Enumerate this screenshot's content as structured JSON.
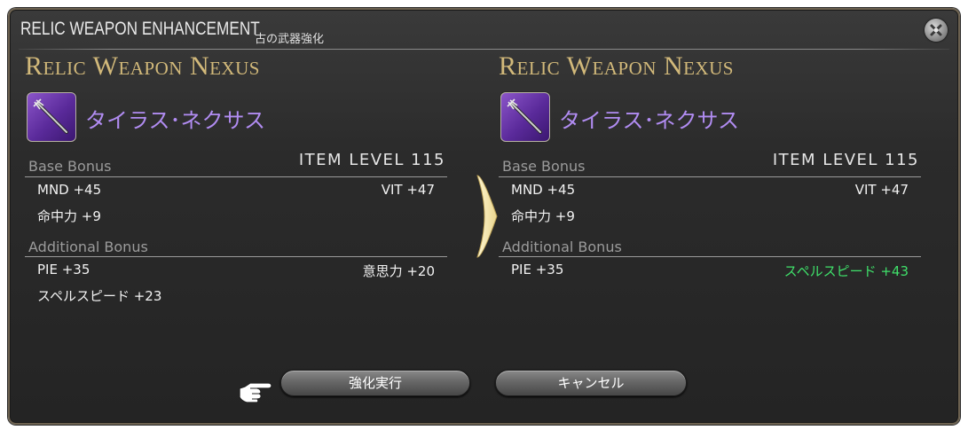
{
  "window": {
    "title_en": "RELIC WEAPON ENHANCEMENT",
    "title_jp": "古の武器強化"
  },
  "before": {
    "header": "Relic Weapon Nexus",
    "weapon_name": "タイラス･ネクサス",
    "base_bonus_label": "Base Bonus",
    "item_level": "ITEM LEVEL 115",
    "base_stats": [
      {
        "label": "MND +45"
      },
      {
        "label": "VIT +47"
      },
      {
        "label": "命中力 +9"
      }
    ],
    "additional_bonus_label": "Additional Bonus",
    "additional_stats": [
      {
        "label": "PIE +35"
      },
      {
        "label": "意思力 +20"
      },
      {
        "label": "スペルスピード +23"
      }
    ]
  },
  "after": {
    "header": "Relic Weapon Nexus",
    "weapon_name": "タイラス･ネクサス",
    "base_bonus_label": "Base Bonus",
    "item_level": "ITEM LEVEL 115",
    "base_stats": [
      {
        "label": "MND +45"
      },
      {
        "label": "VIT +47"
      },
      {
        "label": "命中力 +9"
      }
    ],
    "additional_bonus_label": "Additional Bonus",
    "additional_stats": [
      {
        "label": "PIE +35"
      },
      {
        "label": "スペルスピード +43"
      }
    ]
  },
  "buttons": {
    "execute_label": "強化実行",
    "cancel_label": "キャンセル"
  },
  "colors": {
    "header_gold": "#d2b97a",
    "weapon_name_purple": "#b18cf2",
    "improved_stat_green": "#3fe06a",
    "arrow_cream": "#f4e7b0"
  },
  "icons": {
    "close": "close-icon",
    "weapon": "staff-icon",
    "arrow": "arrow-right-icon",
    "pointer": "pointing-hand-icon"
  }
}
